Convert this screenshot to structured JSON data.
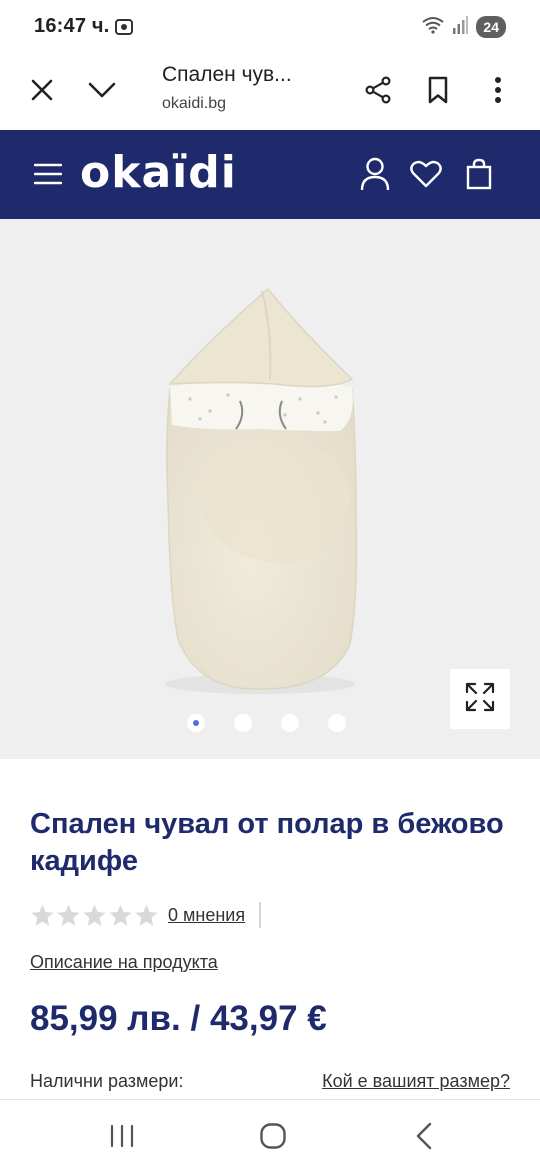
{
  "status_bar": {
    "time": "16:47 ч.",
    "battery": "24",
    "icons": [
      "screen-record-icon",
      "wifi-icon",
      "signal-icon"
    ]
  },
  "browser": {
    "page_title": "Спален чув...",
    "domain": "okaidi.bg",
    "icons": [
      "close-icon",
      "chevron-down-icon",
      "share-icon",
      "bookmark-icon",
      "more-vert-icon"
    ]
  },
  "site_header": {
    "logo": "okaïdi",
    "brand_color": "#1e2a6b",
    "icons": [
      "menu-icon",
      "account-icon",
      "heart-icon",
      "bag-icon"
    ]
  },
  "gallery": {
    "slide_count": 4,
    "active_index": 0,
    "product_color": "#efe9da",
    "icons": [
      "expand-icon"
    ]
  },
  "product": {
    "title": "Спален чувал от полар в бежово кадифе",
    "rating_stars": 0,
    "rating_max": 5,
    "reviews": "0 мнения",
    "description_link": "Описание на продукта",
    "price": "85,99 лв. / 43,97 €",
    "sizes_label": "Налични размери:",
    "size_guide_link": "Кой е вашият размер?"
  },
  "nav_bar": {
    "icons": [
      "recent-apps-icon",
      "home-icon",
      "back-icon"
    ]
  }
}
